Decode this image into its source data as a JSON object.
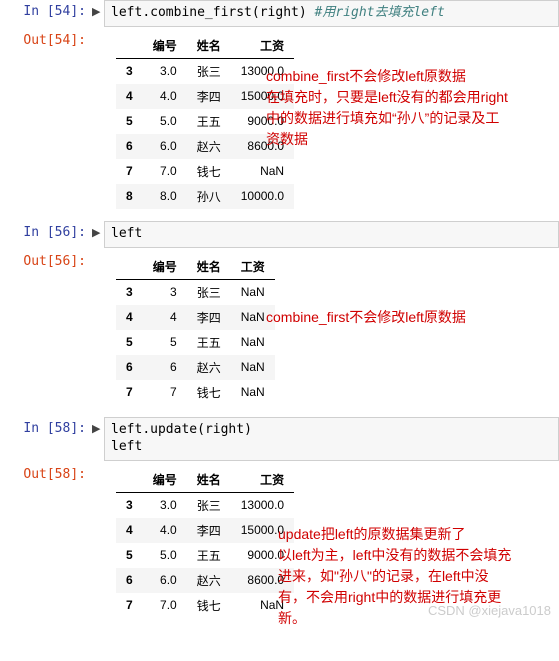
{
  "cells": [
    {
      "in_prompt": "In [54]:",
      "out_prompt": "Out[54]:",
      "code_html": "<span class='tok-ident'>left</span>.<span class='tok-ident'>combine_first</span>(<span class='tok-ident'>right</span>) <span class='tok-comment'>#用right去填充left</span>",
      "table": {
        "columns": [
          "编号",
          "姓名",
          "工资"
        ],
        "index": [
          "3",
          "4",
          "5",
          "6",
          "7",
          "8"
        ],
        "rows": [
          [
            "3.0",
            "张三",
            "13000.0"
          ],
          [
            "4.0",
            "李四",
            "15000.0"
          ],
          [
            "5.0",
            "王五",
            "9000.0"
          ],
          [
            "6.0",
            "赵六",
            "8600.0"
          ],
          [
            "7.0",
            "钱七",
            "NaN"
          ],
          [
            "8.0",
            "孙八",
            "10000.0"
          ]
        ]
      }
    },
    {
      "in_prompt": "In [56]:",
      "out_prompt": "Out[56]:",
      "code_html": "<span class='tok-ident'>left</span>",
      "table": {
        "columns": [
          "编号",
          "姓名",
          "工资"
        ],
        "index": [
          "3",
          "4",
          "5",
          "6",
          "7"
        ],
        "rows": [
          [
            "3",
            "张三",
            "NaN"
          ],
          [
            "4",
            "李四",
            "NaN"
          ],
          [
            "5",
            "王五",
            "NaN"
          ],
          [
            "6",
            "赵六",
            "NaN"
          ],
          [
            "7",
            "钱七",
            "NaN"
          ]
        ]
      }
    },
    {
      "in_prompt": "In [58]:",
      "out_prompt": "Out[58]:",
      "code_html": "<span class='tok-ident'>left</span>.<span class='tok-ident'>update</span>(<span class='tok-ident'>right</span>)\n<span class='tok-ident'>left</span>",
      "table": {
        "columns": [
          "编号",
          "姓名",
          "工资"
        ],
        "index": [
          "3",
          "4",
          "5",
          "6",
          "7"
        ],
        "rows": [
          [
            "3.0",
            "张三",
            "13000.0"
          ],
          [
            "4.0",
            "李四",
            "15000.0"
          ],
          [
            "5.0",
            "王五",
            "9000.0"
          ],
          [
            "6.0",
            "赵六",
            "8600.0"
          ],
          [
            "7.0",
            "钱七",
            "NaN"
          ]
        ]
      }
    }
  ],
  "annotations": {
    "a1_l1": "combine_first不会修改left原数据",
    "a1_l2": "在填充时，只要是left没有的都会用right",
    "a1_l3": "中的数据进行填充如“孙八”的记录及工",
    "a1_l4": "资数据",
    "a2_l1": "combine_first不会修改left原数据",
    "a3_l1": "update把left的原数据集更新了",
    "a3_l2": "以left为主，left中没有的数据不会填充",
    "a3_l3": "进来，如\"孙八\"的记录，在left中没",
    "a3_l4": "有，不会用right中的数据进行填充更",
    "a3_l5": "新。"
  },
  "watermark": "CSDN @xiejava1018"
}
